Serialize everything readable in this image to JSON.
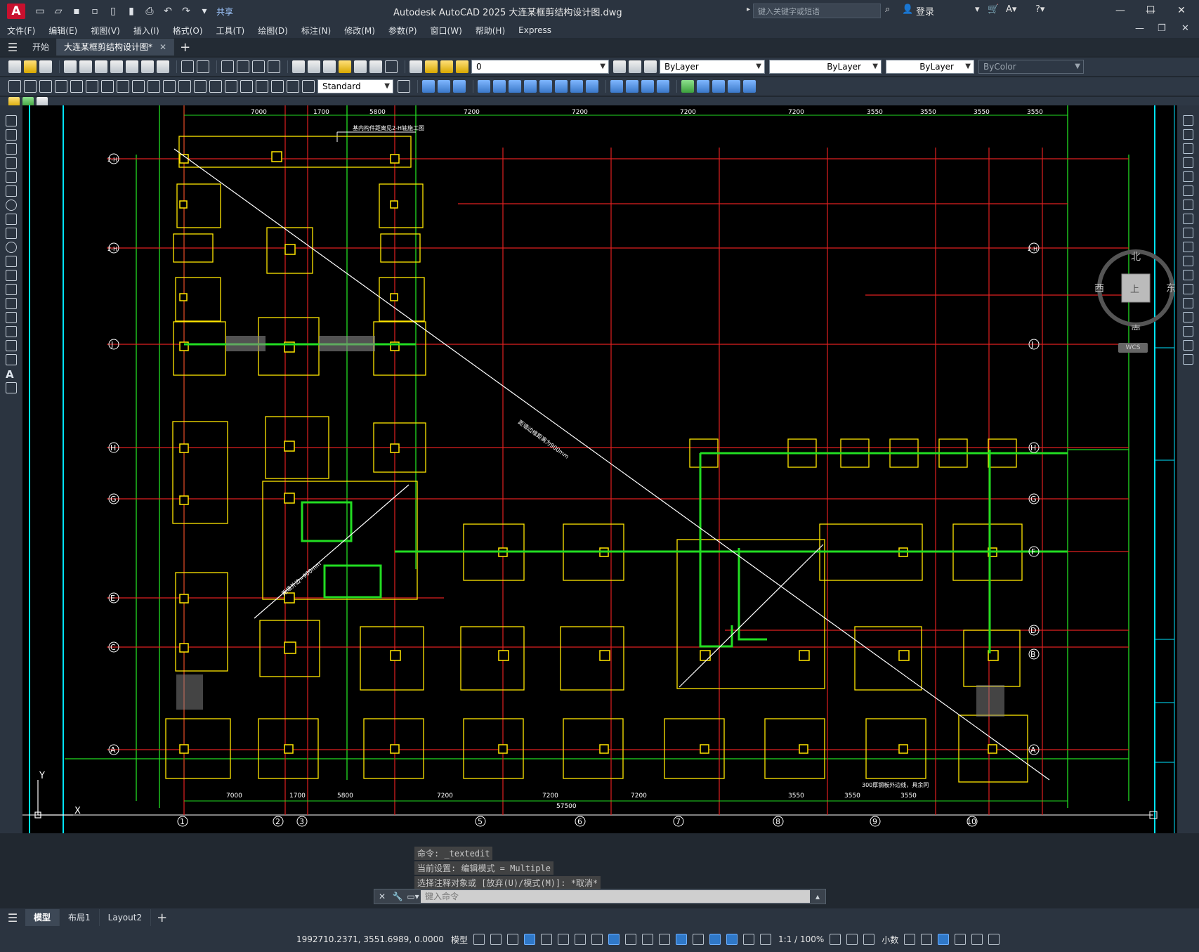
{
  "app": {
    "logo": "A",
    "share_label": "共享",
    "title": "Autodesk AutoCAD 2025    大连某框剪结构设计图.dwg",
    "search_placeholder": "键入关键字或短语",
    "login": "登录"
  },
  "menu": [
    "文件(F)",
    "编辑(E)",
    "视图(V)",
    "插入(I)",
    "格式(O)",
    "工具(T)",
    "绘图(D)",
    "标注(N)",
    "修改(M)",
    "参数(P)",
    "窗口(W)",
    "帮助(H)",
    "Express"
  ],
  "tabs": {
    "start": "开始",
    "doc": "大连某框剪结构设计图*"
  },
  "toolbar": {
    "layer": "0",
    "color": "ByLayer",
    "linetype": "ByLayer",
    "lineweight": "ByLayer",
    "plotstyle": "ByColor",
    "textstyle": "Standard"
  },
  "viewcube": {
    "north": "北",
    "south": "南",
    "east": "东",
    "west": "西",
    "face": "上",
    "wcs": "WCS"
  },
  "drawing": {
    "grid_rows": [
      "2-H",
      "2-H",
      "J",
      "H",
      "G",
      "F",
      "E",
      "C",
      "D",
      "B",
      "A"
    ],
    "grid_cols": [
      "1",
      "2",
      "3",
      "5",
      "6",
      "7",
      "8",
      "9",
      "10"
    ],
    "top_dims": [
      "7000",
      "1700",
      "5800",
      "7200",
      "7200",
      "7200",
      "7200",
      "3550",
      "3550",
      "3550",
      "3550"
    ],
    "bottom_dims": [
      "7000",
      "1700",
      "5800",
      "7200",
      "7200",
      "7200",
      "3550",
      "3550",
      "3550"
    ],
    "total_dim": "57500",
    "note_top": "基内构件距离见2-H轴施工图",
    "note_right": "300厚钢板外边线，具余同",
    "note_diag1": "距墙边缘距离为900mm",
    "note_diag2": "距墙外边=900mm",
    "axis_x": "X",
    "axis_y": "Y"
  },
  "command": {
    "history": [
      "命令: _textedit",
      "当前设置: 编辑模式 = Multiple",
      "选择注释对象或 [放弃(U)/模式(M)]: *取消*"
    ],
    "placeholder": "键入命令"
  },
  "layout_tabs": [
    "模型",
    "布局1",
    "Layout2"
  ],
  "status": {
    "coords": "1992710.2371, 3551.6989, 0.0000",
    "model": "模型",
    "scale": "1:1 / 100%",
    "units": "小数"
  }
}
